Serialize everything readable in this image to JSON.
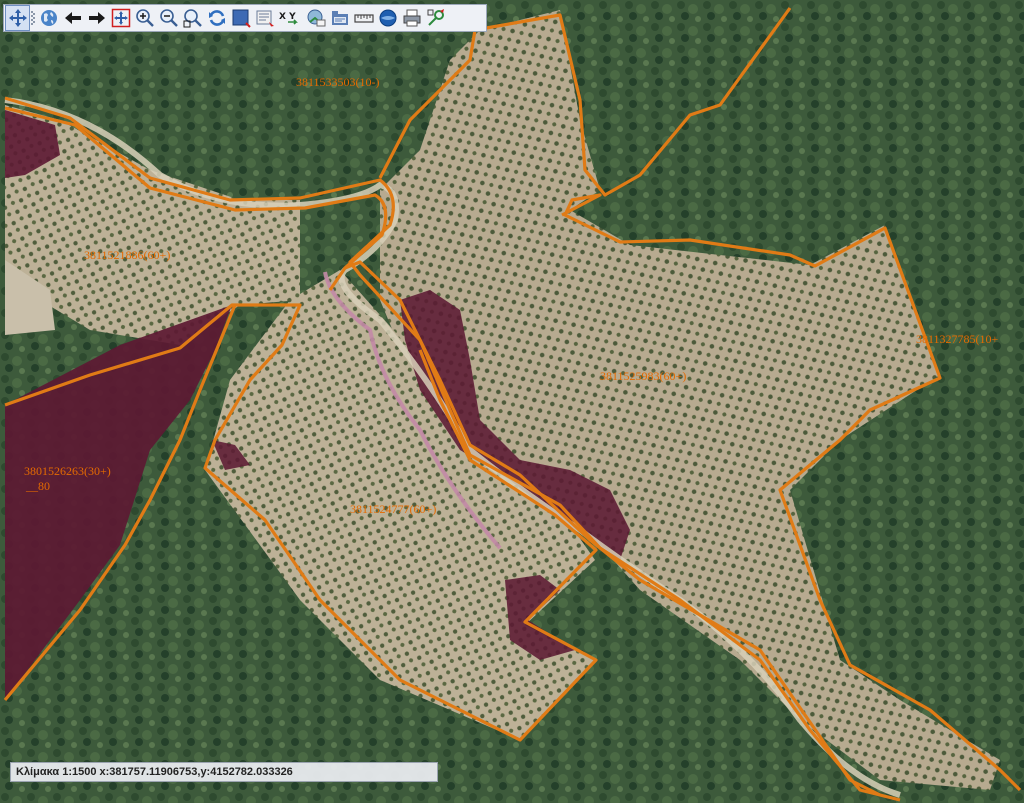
{
  "toolbar": {
    "tools": [
      {
        "name": "pan-icon"
      },
      {
        "name": "grip-icon"
      },
      {
        "name": "globe-icon"
      },
      {
        "name": "arrow-left-icon"
      },
      {
        "name": "arrow-right-icon"
      },
      {
        "name": "full-extent-icon"
      },
      {
        "name": "zoom-in-icon"
      },
      {
        "name": "zoom-out-icon"
      },
      {
        "name": "zoom-box-icon"
      },
      {
        "name": "refresh-icon"
      },
      {
        "name": "select-rectangle-icon"
      },
      {
        "name": "identify-icon"
      },
      {
        "name": "coordinates-icon",
        "label": "X Y"
      },
      {
        "name": "map-info-icon"
      },
      {
        "name": "layers-icon"
      },
      {
        "name": "ruler-icon"
      },
      {
        "name": "world-map-icon"
      },
      {
        "name": "print-icon"
      },
      {
        "name": "settings-icon"
      }
    ]
  },
  "parcels": [
    {
      "label": "3811533503(10-)"
    },
    {
      "label": "3811521886(60+)"
    },
    {
      "label": "3811525983(60+)"
    },
    {
      "label": "3811327785(10+"
    },
    {
      "label": "3801526263(30+)"
    },
    {
      "label": "__80"
    },
    {
      "label": "3811524777(60+)"
    }
  ],
  "status": {
    "text": "Κλίμακα 1:1500 x:381757.11906753,y:4152782.033326"
  },
  "colors": {
    "parcel_border": "#e07b16",
    "label": "#e46a00",
    "excluded_area": "#6b1f3a",
    "forest": "#3f5c3b",
    "grove": "#b8ab90"
  }
}
